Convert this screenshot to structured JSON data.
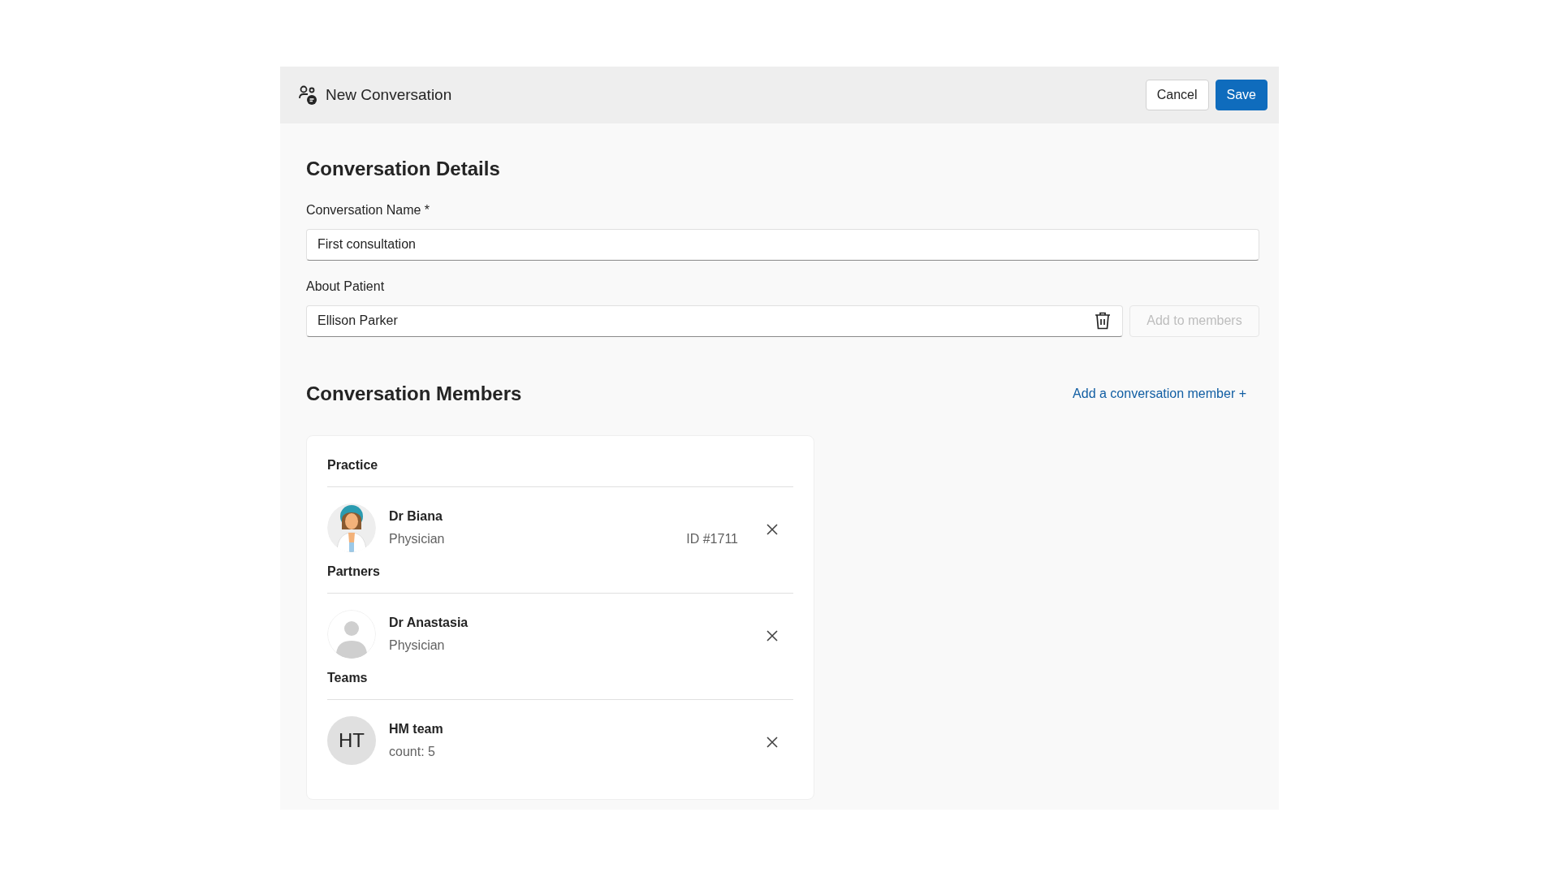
{
  "window": {
    "title": "New Conversation"
  },
  "header_buttons": [
    {
      "label": "Cancel",
      "kind": "secondary"
    },
    {
      "label": "Save",
      "kind": "primary"
    }
  ],
  "details": {
    "heading": "Conversation Details",
    "fields": [
      {
        "label": "Conversation Name *",
        "value": "First consultation"
      },
      {
        "label": "About Patient",
        "value": "Ellison Parker",
        "clearable": true,
        "action": {
          "label": "Add to members",
          "disabled": true
        }
      }
    ]
  },
  "members": {
    "heading": "Conversation Members",
    "add_link": "Add a conversation member +",
    "groups": [
      {
        "title": "Practice",
        "items": [
          {
            "name": "Dr Biana",
            "subtitle": "Physician",
            "id": "ID #1711",
            "avatar": {
              "kind": "illustration"
            }
          }
        ]
      },
      {
        "title": "Partners",
        "items": [
          {
            "name": "Dr Anastasia",
            "subtitle": "Physician",
            "avatar": {
              "kind": "placeholder"
            }
          }
        ]
      },
      {
        "title": "Teams",
        "items": [
          {
            "name": "HM team",
            "subtitle": "count: 5",
            "avatar": {
              "kind": "initials",
              "text": "HT"
            }
          }
        ]
      }
    ]
  }
}
